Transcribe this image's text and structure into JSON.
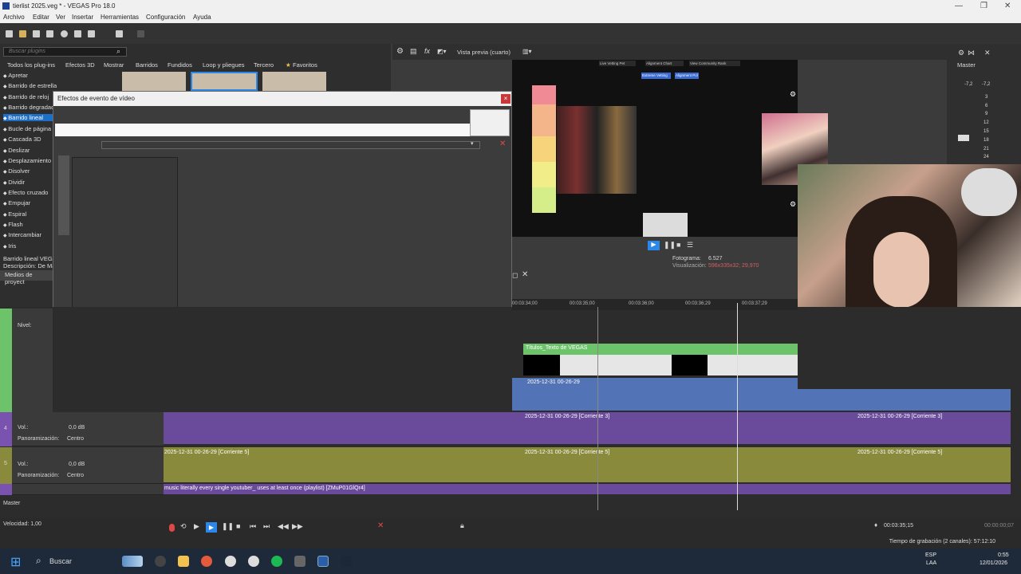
{
  "window": {
    "title": "tierlist 2025.veg * - VEGAS Pro 18.0"
  },
  "menu": [
    "Archivo",
    "Editar",
    "Ver",
    "Insertar",
    "Herramientas",
    "Configuración",
    "Ayuda"
  ],
  "plugins": {
    "search_placeholder": "Buscar plugins",
    "tabs": [
      "Todos los plug-ins",
      "Efectos 3D",
      "Mostrar",
      "Barridos",
      "Fundidos",
      "Loop y pliegues",
      "Tercero",
      "Favoritos"
    ],
    "items": [
      "Apretar",
      "Barrido de estrella",
      "Barrido de reloj",
      "Barrido degradado",
      "Barrido lineal",
      "Bucle de página",
      "Cascada 3D",
      "Deslizar",
      "Desplazamiento",
      "Disolver",
      "Dividir",
      "Efecto cruzado",
      "Empujar",
      "Espiral",
      "Flash",
      "Intercambiar",
      "Iris"
    ],
    "selected": "Barrido lineal",
    "desc_name": "Barrido lineal VEGAS",
    "desc_text": "Descripción: De Ma",
    "media_label": "Medios de proyect"
  },
  "dialog": {
    "title": "Efectos de evento de vídeo",
    "close": "×"
  },
  "preview": {
    "mode_label": "Vista previa (cuarto)",
    "frame_label": "Fotograma:",
    "frame_value": "6.527",
    "display_label": "Visualización:",
    "display_value": "596x335x32; 29,970",
    "top_buttons": [
      "Live Vetting Pet",
      "Alignment Chart",
      "View Community Rank"
    ],
    "sub_buttons": [
      "Extreme Vetting",
      "Alignment Pol"
    ]
  },
  "master": {
    "label": "Master",
    "db_left": "-7,2",
    "db_right": "-7,2",
    "scale": [
      "3",
      "6",
      "9",
      "12",
      "15",
      "18",
      "21",
      "24"
    ]
  },
  "ruler": [
    "00:03:34;00",
    "00:03:35;00",
    "00:03:36;00",
    "00:03:36;29",
    "00:03:37;29"
  ],
  "tracks": {
    "level_label": "Nivel:",
    "audio1": {
      "vol_label": "Vol.:",
      "vol_value": "0,0 dB",
      "pan_label": "Panoramización:",
      "pan_value": "Centro",
      "num": "4"
    },
    "audio2": {
      "vol_label": "Vol.:",
      "vol_value": "0,0 dB",
      "pan_label": "Panoramización:",
      "pan_value": "Centro",
      "num": "5"
    },
    "master_label": "Master",
    "meter_vals": [
      "24",
      "36",
      "48",
      "-8.8",
      "12",
      "24",
      "36",
      "48",
      "-29.5"
    ]
  },
  "clips": {
    "titles": "Títulos_Texto de VEGAS",
    "video": "2025-12-31 00-26-29",
    "audio3": "2025-12-31 00-26-29 [Corriente 3]",
    "audio5": "2025-12-31 00-26-29 [Corriente 5]",
    "music": "music literally every single youtuber_ uses at least once (playlist) [ZMuP01GlQr4]"
  },
  "transport": {
    "speed_label": "Velocidad: 1,00",
    "time": "00:03:35;15",
    "time2": "00:00:00;07"
  },
  "status": {
    "rec_time": "Tiempo de grabación (2 canales): 57:12:10"
  },
  "taskbar": {
    "search": "Buscar",
    "lang1": "ESP",
    "lang2": "LAA",
    "clock": "0:55",
    "date": "12/01/2026"
  }
}
